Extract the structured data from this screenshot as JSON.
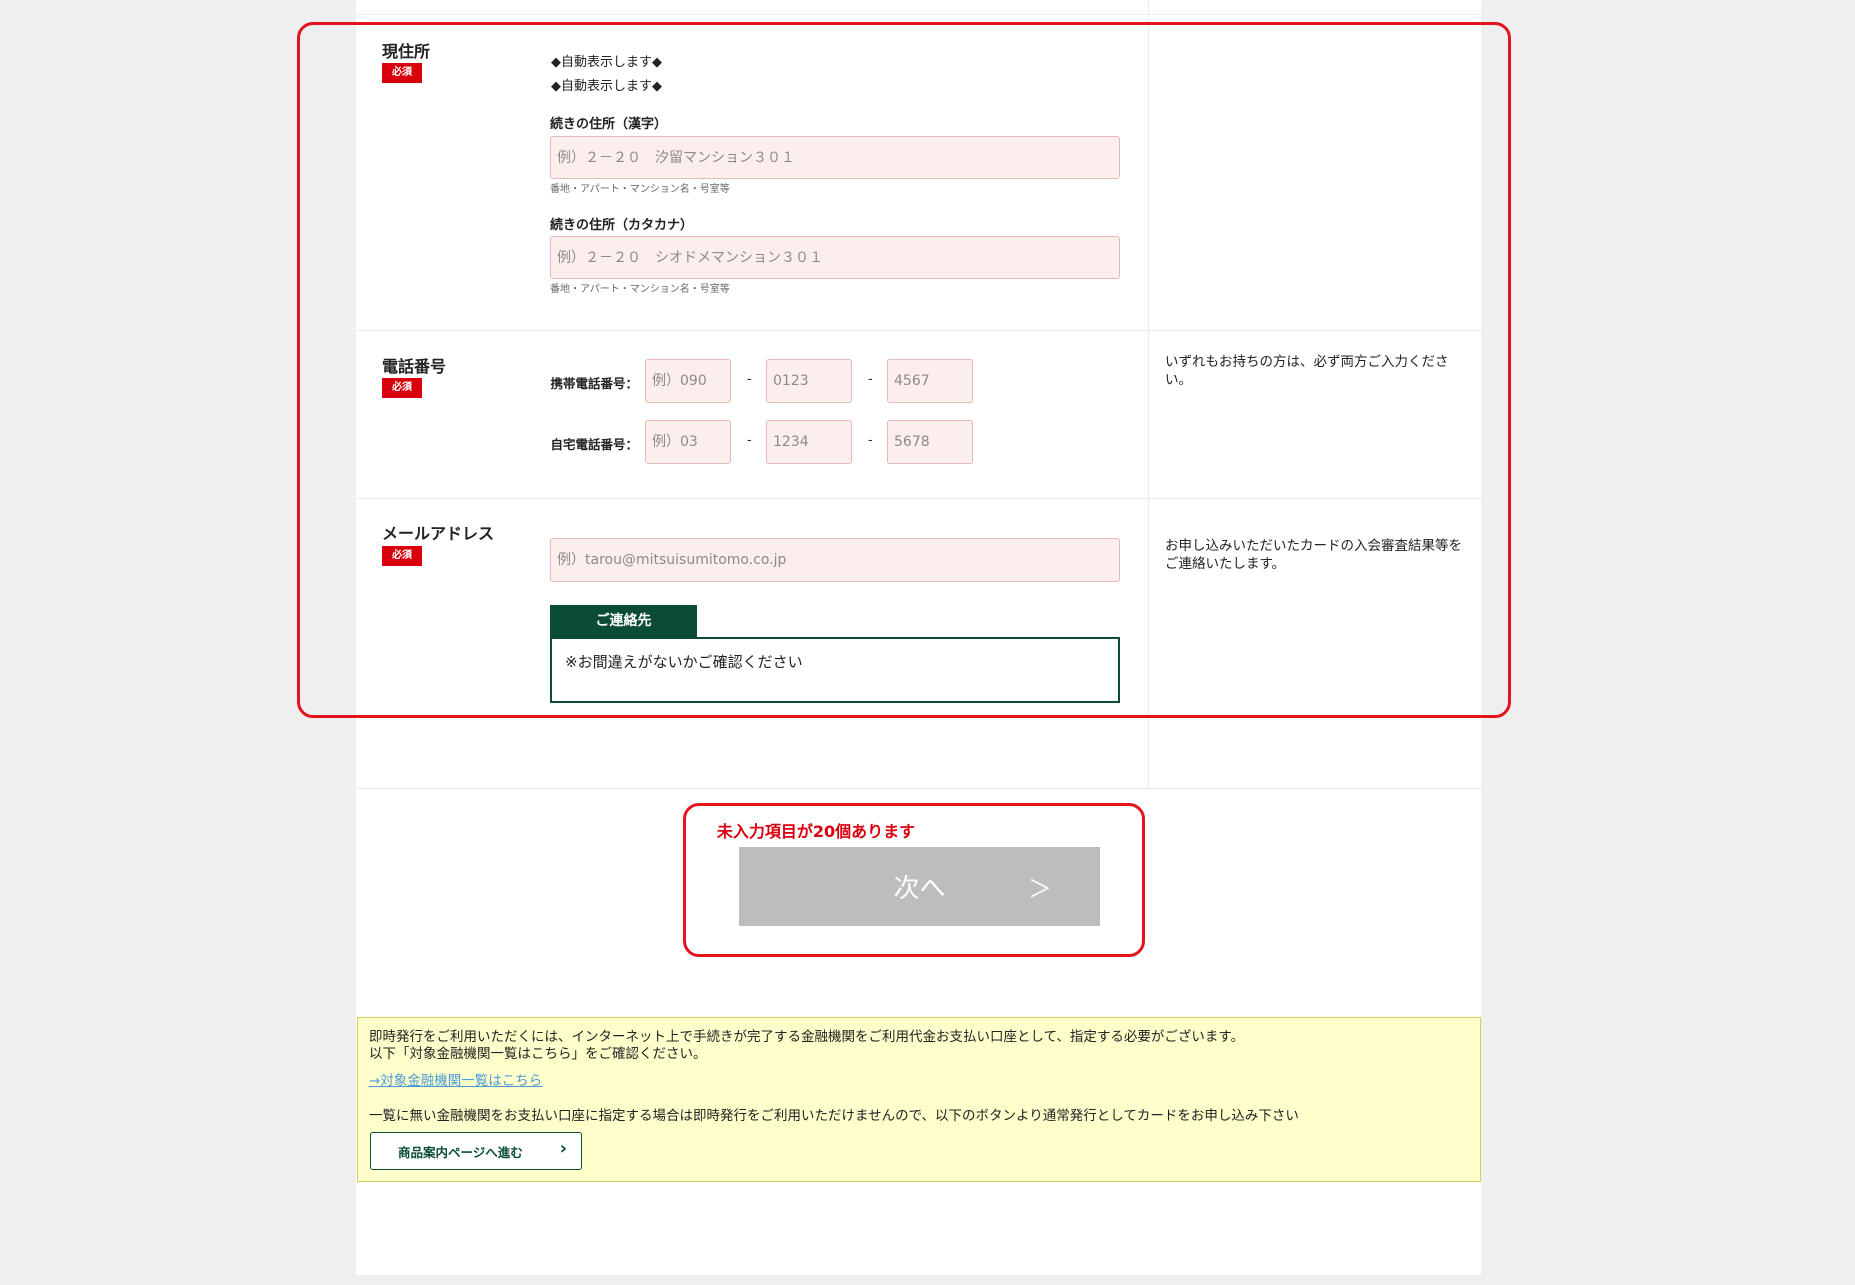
{
  "address": {
    "label": "現住所",
    "required": "必須",
    "auto_lines": [
      "◆自動表示します◆",
      "◆自動表示します◆"
    ],
    "kanji_label": "続きの住所（漢字）",
    "kanji_placeholder": "例）２－２０　汐留マンション３０１",
    "kanji_hint": "番地・アパート・マンション名・号室等",
    "kana_label": "続きの住所（カタカナ）",
    "kana_placeholder": "例）２－２０　シオドメマンション３０１",
    "kana_hint": "番地・アパート・マンション名・号室等"
  },
  "phone": {
    "label": "電話番号",
    "required": "必須",
    "mobile_label": "携帯電話番号：",
    "mobile_placeholders": [
      "例）090",
      "0123",
      "4567"
    ],
    "home_label": "自宅電話番号：",
    "home_placeholders": [
      "例）03",
      "1234",
      "5678"
    ],
    "dash": "-",
    "note": "いずれもお持ちの方は、必ず両方ご入力ください。"
  },
  "email": {
    "label": "メールアドレス",
    "required": "必須",
    "placeholder": "例）tarou@mitsuisumitomo.co.jp",
    "note": "お申し込みいただいたカードの入会審査結果等をご連絡いたします。",
    "contact_tab": "ご連絡先",
    "contact_text": "※お間違えがないかご確認ください"
  },
  "submit": {
    "warning": "未入力項目が20個あります",
    "next_label": "次へ",
    "next_arrow": "＞"
  },
  "notice": {
    "line1": "即時発行をご利用いただくには、インターネット上で手続きが完了する金融機関をご利用代金お支払い口座として、指定する必要がございます。",
    "line2": "以下「対象金融機関一覧はこちら」をご確認ください。",
    "link": "→対象金融機関一覧はこちら",
    "line3": "一覧に無い金融機関をお支払い口座に指定する場合は即時発行をご利用いただけませんので、以下のボタンより通常発行としてカードをお申し込み下さい",
    "button": "商品案内ページへ進む",
    "button_arrow": "›"
  },
  "colors": {
    "required_red": "#d9000d",
    "highlight_frame": "#e3141e",
    "brand_green": "#0a4d34",
    "input_bg": "#fdeeee",
    "notice_bg": "#ffffcc",
    "link_blue": "#4a9bd6"
  }
}
